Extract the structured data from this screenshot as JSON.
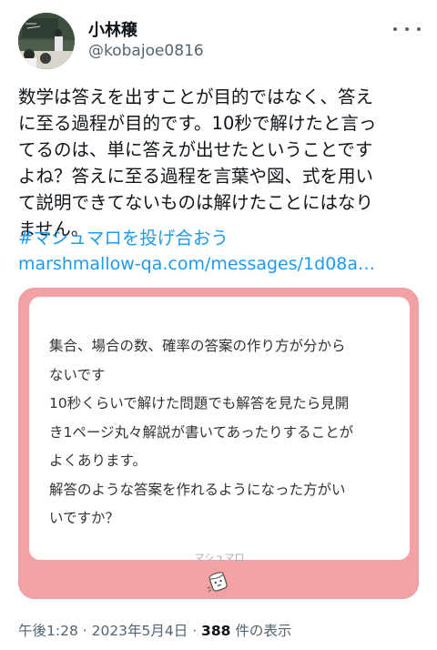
{
  "author": {
    "display_name": "小林穣",
    "handle": "@kobajoe0816"
  },
  "tweet": {
    "text_lines": [
      "数学は答えを出すことが目的ではなく、答え",
      "に至る過程が目的です。10秒で解けたと言っ",
      "てるのは、単に答えが出せたということです",
      "よね？答えに至る過程を言葉や図、式を用い",
      "て説明できてないものは解けたことにはなり",
      "ません。"
    ],
    "hashtag": "#マシュマロを投げ合おう",
    "link": "marshmallow-qa.com/messages/1d08a…"
  },
  "card": {
    "question_lines": [
      "集合、場合の数、確率の答案の作り方が分から",
      "ないです",
      "10秒くらいで解けた問題でも解答を見たら見開",
      "き1ページ丸々解説が書いてあったりすることが",
      "よくあります。",
      "解答のような答案を作れるようになった方がい",
      "いですか？"
    ],
    "brand_label": "マシュマロ",
    "icon": "marshmallow-icon"
  },
  "meta": {
    "time": "午後1:28",
    "sep1": " · ",
    "date": "2023年5月4日",
    "sep2": " · ",
    "views_count": "388",
    "views_suffix": " 件の表示"
  },
  "colors": {
    "link": "#1d9bf0",
    "card_border": "#f3a1a4",
    "secondary_text": "#536471"
  }
}
